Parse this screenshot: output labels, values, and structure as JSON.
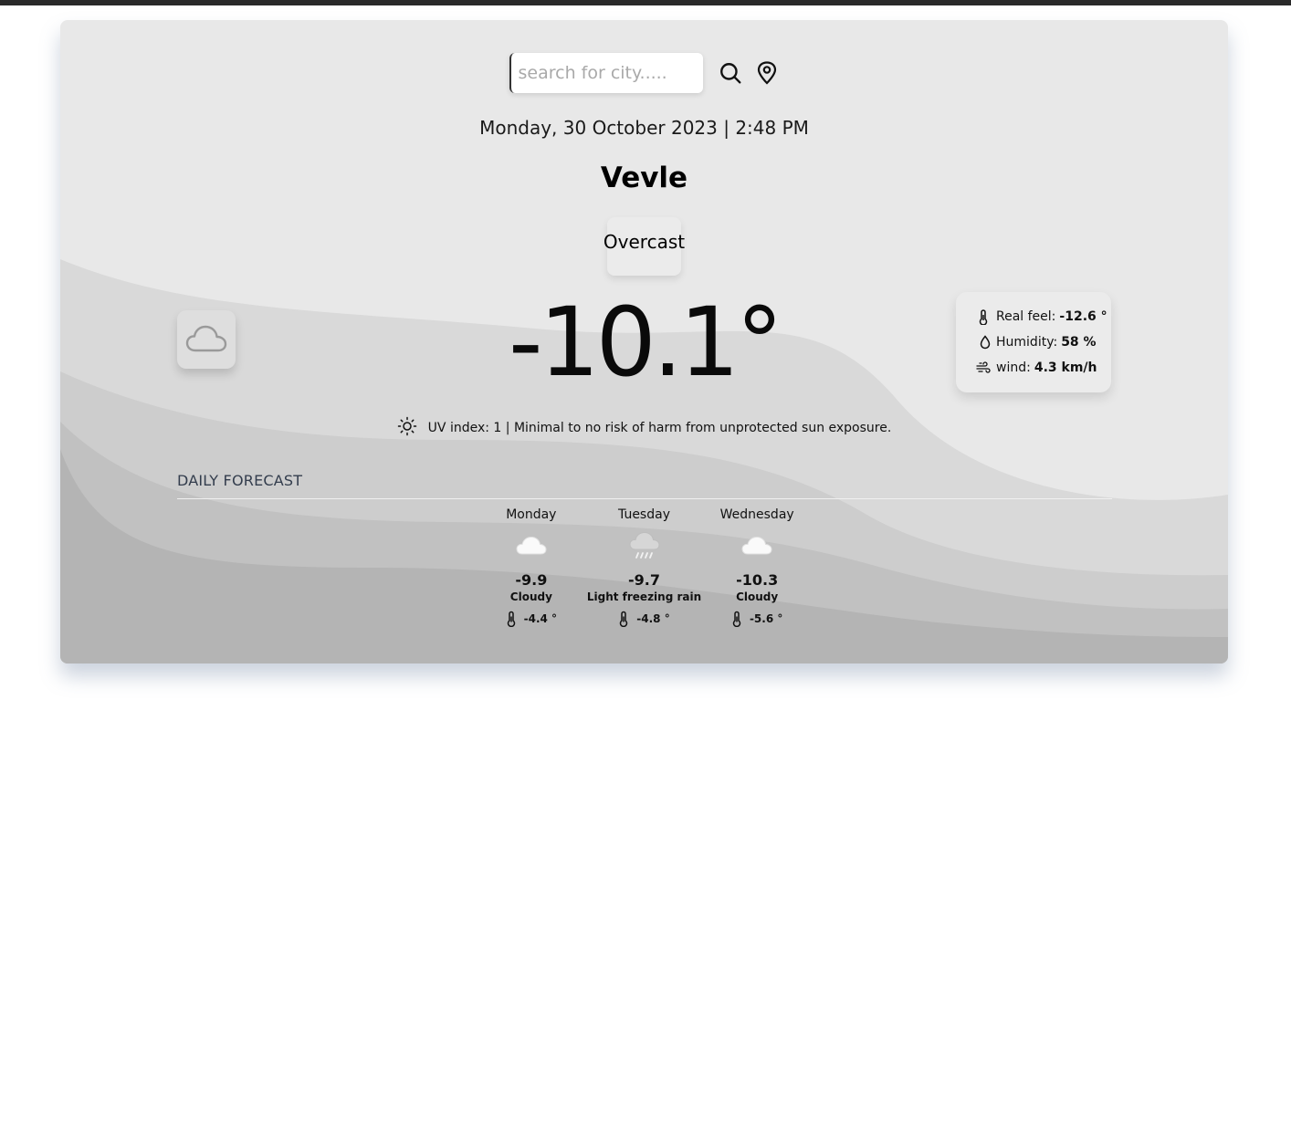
{
  "search": {
    "placeholder": "search for city....."
  },
  "header": {
    "datetime": "Monday, 30 October 2023 | 2:48 PM",
    "city": "Vevle",
    "condition": "Overcast"
  },
  "current": {
    "temperature": "-10.1°",
    "icon": "cloud-icon",
    "details": {
      "real_feel_label": "Real feel:",
      "real_feel_value": "-12.6 °",
      "humidity_label": "Humidity:",
      "humidity_value": "58 %",
      "wind_label": "wind:",
      "wind_value": "4.3 km/h"
    },
    "uv_text": "UV index: 1 | Minimal to no risk of harm from unprotected sun exposure."
  },
  "forecast": {
    "title": "DAILY FORECAST",
    "days": [
      {
        "name": "Monday",
        "icon": "cloud-icon",
        "temp": "-9.9",
        "condition": "Cloudy",
        "feel": "-4.4 °"
      },
      {
        "name": "Tuesday",
        "icon": "rain-cloud-icon",
        "temp": "-9.7",
        "condition": "Light freezing rain",
        "feel": "-4.8 °"
      },
      {
        "name": "Wednesday",
        "icon": "cloud-icon",
        "temp": "-10.3",
        "condition": "Cloudy",
        "feel": "-5.6 °"
      }
    ]
  },
  "colors": {
    "card_bg": "#e8e8e8",
    "wave_1": "#d9d9d9",
    "wave_2": "#cdcdcd",
    "wave_3": "#c1c1c1",
    "wave_4": "#b4b4b4"
  }
}
